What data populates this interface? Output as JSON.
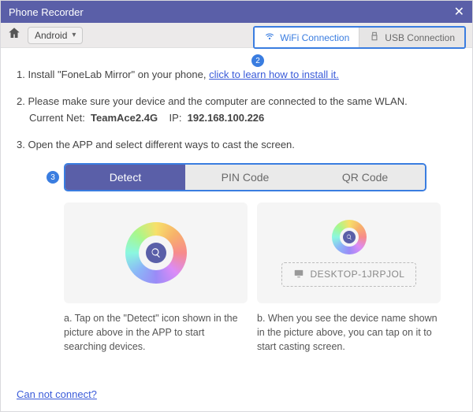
{
  "title": "Phone Recorder",
  "toolbar": {
    "platform": "Android",
    "conn_tabs": {
      "wifi": "WiFi Connection",
      "usb": "USB Connection"
    }
  },
  "badges": {
    "two": "2",
    "three": "3"
  },
  "steps": {
    "s1_pre": "1. Install \"FoneLab Mirror\" on your phone, ",
    "s1_link": "click to learn how to install it.",
    "s2_text": "2. Please make sure your device and the computer are connected to the same WLAN.",
    "s2_net_label": "Current Net:",
    "s2_net_value": "TeamAce2.4G",
    "s2_ip_label": "IP:",
    "s2_ip_value": "192.168.100.226",
    "s3_text": "3. Open the APP and select different ways to cast the screen."
  },
  "methods": {
    "detect": "Detect",
    "pin": "PIN Code",
    "qr": "QR Code"
  },
  "device_name": "DESKTOP-1JRPJOL",
  "captions": {
    "a": "a. Tap on the \"Detect\" icon shown in the picture above in the APP to start searching devices.",
    "b": "b. When you see the device name shown in the picture above, you can tap on it to start casting screen."
  },
  "footer_link": "Can not connect?"
}
